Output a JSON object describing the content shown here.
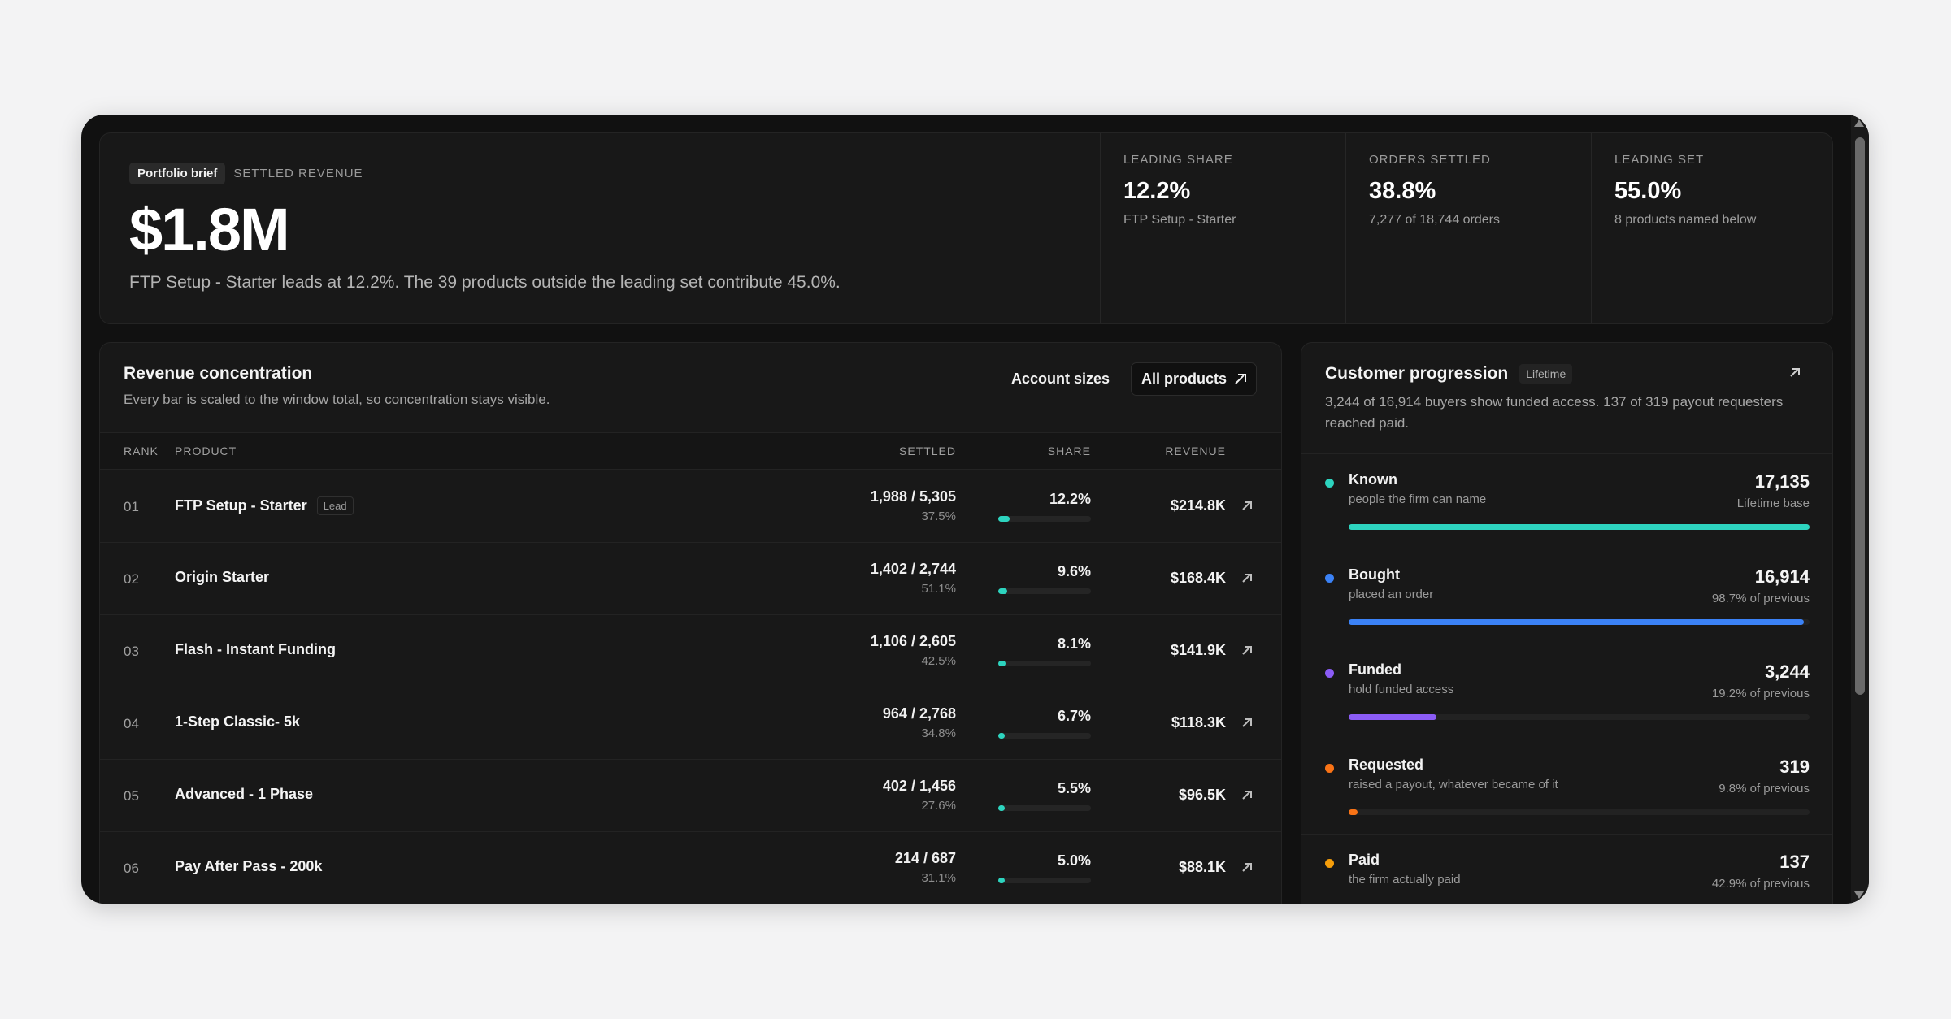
{
  "hero": {
    "badge": "Portfolio brief",
    "eyebrow": "SETTLED REVENUE",
    "amount": "$1.8M",
    "description": "FTP Setup - Starter leads at 12.2%. The 39 products outside the leading set contribute 45.0%."
  },
  "kpis": [
    {
      "label": "LEADING SHARE",
      "value": "12.2%",
      "sub": "FTP Setup - Starter"
    },
    {
      "label": "ORDERS SETTLED",
      "value": "38.8%",
      "sub": "7,277 of 18,744 orders"
    },
    {
      "label": "LEADING SET",
      "value": "55.0%",
      "sub": "8 products named below"
    }
  ],
  "revenue": {
    "title": "Revenue concentration",
    "subtitle": "Every bar is scaled to the window total, so concentration stays visible.",
    "account_sizes": "Account sizes",
    "all_products": "All products",
    "columns": {
      "rank": "RANK",
      "product": "PRODUCT",
      "settled": "SETTLED",
      "share": "SHARE",
      "revenue": "REVENUE"
    },
    "rows": [
      {
        "rank": "01",
        "product": "FTP Setup - Starter",
        "tag": "Lead",
        "settled": "1,988 / 5,305",
        "settled_pct": "37.5%",
        "share": "12.2%",
        "share_value": 12.2,
        "revenue": "$214.8K"
      },
      {
        "rank": "02",
        "product": "Origin Starter",
        "tag": "",
        "settled": "1,402 / 2,744",
        "settled_pct": "51.1%",
        "share": "9.6%",
        "share_value": 9.6,
        "revenue": "$168.4K"
      },
      {
        "rank": "03",
        "product": "Flash - Instant Funding",
        "tag": "",
        "settled": "1,106 / 2,605",
        "settled_pct": "42.5%",
        "share": "8.1%",
        "share_value": 8.1,
        "revenue": "$141.9K"
      },
      {
        "rank": "04",
        "product": "1-Step Classic- 5k",
        "tag": "",
        "settled": "964 / 2,768",
        "settled_pct": "34.8%",
        "share": "6.7%",
        "share_value": 6.7,
        "revenue": "$118.3K"
      },
      {
        "rank": "05",
        "product": "Advanced - 1 Phase",
        "tag": "",
        "settled": "402 / 1,456",
        "settled_pct": "27.6%",
        "share": "5.5%",
        "share_value": 5.5,
        "revenue": "$96.5K"
      },
      {
        "rank": "06",
        "product": "Pay After Pass - 200k",
        "tag": "",
        "settled": "214 / 687",
        "settled_pct": "31.1%",
        "share": "5.0%",
        "share_value": 5.0,
        "revenue": "$88.1K"
      }
    ]
  },
  "customer": {
    "title": "Customer progression",
    "badge": "Lifetime",
    "description": "3,244 of 16,914 buyers show funded access. 137 of 319 payout requesters reached paid.",
    "stages": [
      {
        "name": "Known",
        "sub": "people the firm can name",
        "value": "17,135",
        "note": "Lifetime base",
        "fraction": 1.0,
        "color": "#2dd4bf"
      },
      {
        "name": "Bought",
        "sub": "placed an order",
        "value": "16,914",
        "note": "98.7% of previous",
        "fraction": 0.987,
        "color": "#3b82f6"
      },
      {
        "name": "Funded",
        "sub": "hold funded access",
        "value": "3,244",
        "note": "19.2% of previous",
        "fraction": 0.19,
        "color": "#8b5cf6"
      },
      {
        "name": "Requested",
        "sub": "raised a payout, whatever became of it",
        "value": "319",
        "note": "9.8% of previous",
        "fraction": 0.019,
        "color": "#f97316"
      },
      {
        "name": "Paid",
        "sub": "the firm actually paid",
        "value": "137",
        "note": "42.9% of previous",
        "fraction": 0.008,
        "color": "#f59e0b"
      }
    ]
  }
}
